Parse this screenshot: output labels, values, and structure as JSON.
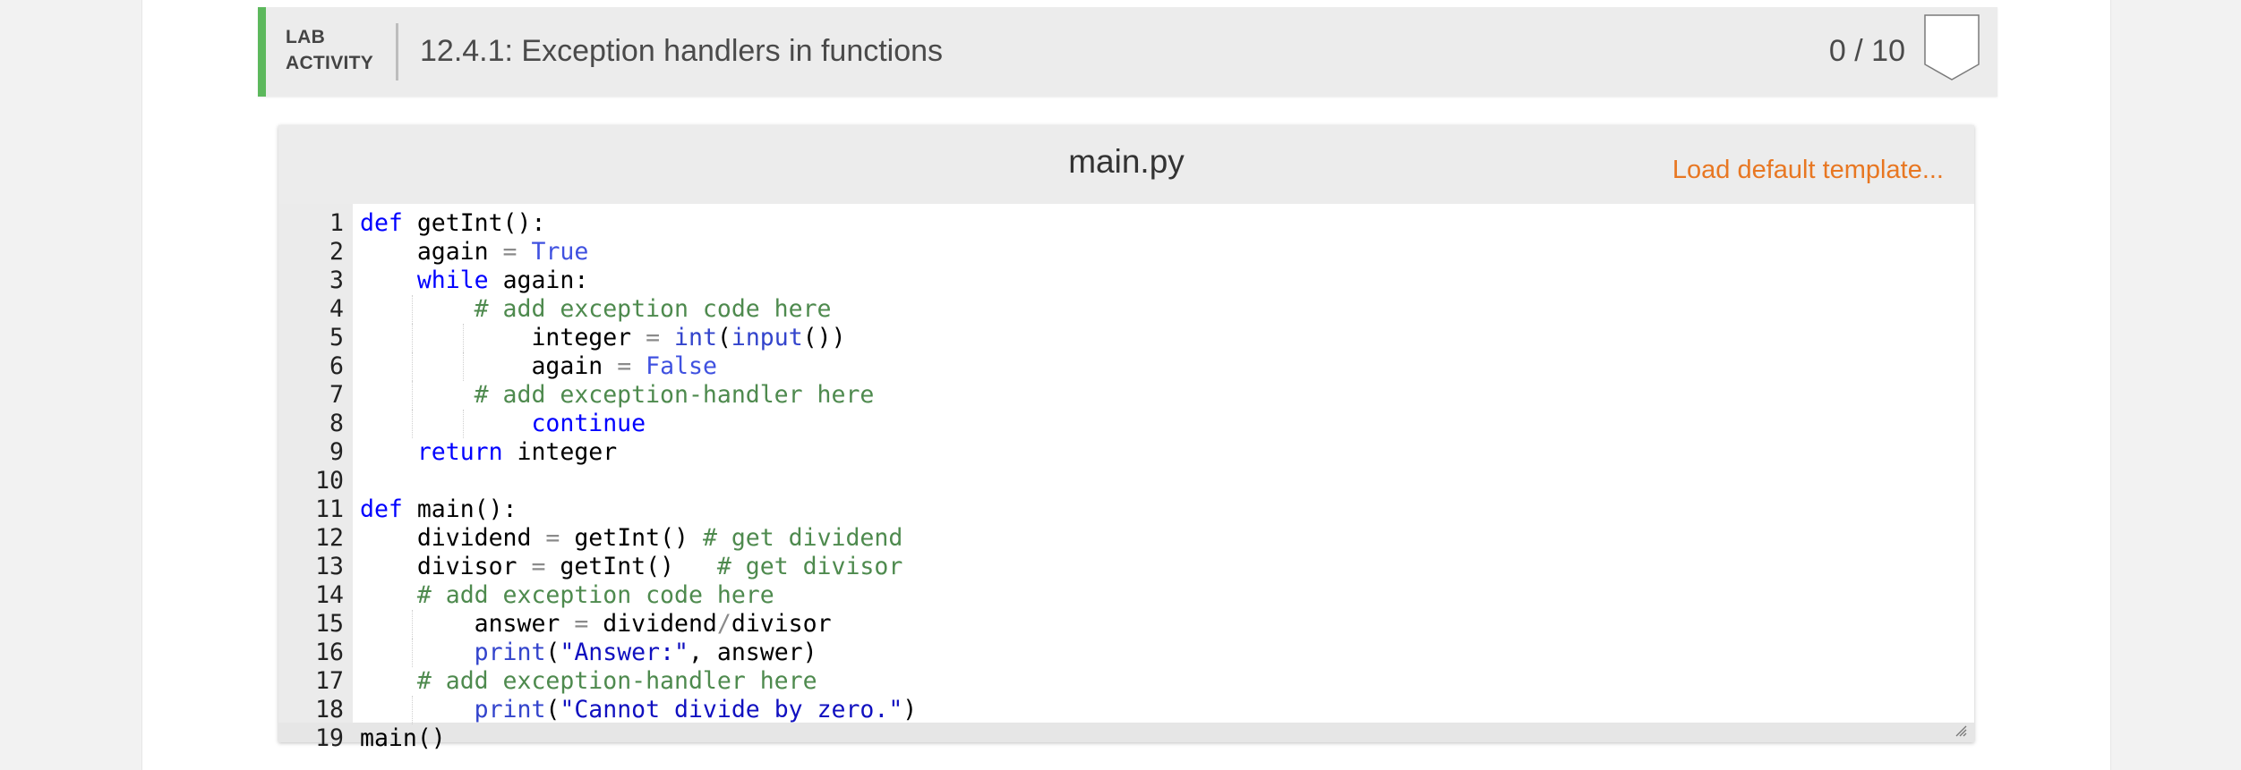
{
  "lab": {
    "label_line1": "LAB",
    "label_line2": "ACTIVITY",
    "title": "12.4.1: Exception handlers in functions",
    "score": "0 / 10",
    "accent_color": "#5cb85c",
    "badge_icon": "shield-badge-icon"
  },
  "editor": {
    "file_name": "main.py",
    "load_template_label": "Load default template...",
    "load_template_color": "#e87722",
    "line_numbers": [
      "1",
      "2",
      "3",
      "4",
      "5",
      "6",
      "7",
      "8",
      "9",
      "10",
      "11",
      "12",
      "13",
      "14",
      "15",
      "16",
      "17",
      "18",
      "19"
    ],
    "lines": [
      [
        {
          "t": "def",
          "c": "kw"
        },
        {
          "t": " getInt():"
        }
      ],
      [
        {
          "t": "    again "
        },
        {
          "t": "=",
          "c": "op"
        },
        {
          "t": " "
        },
        {
          "t": "True",
          "c": "lit"
        }
      ],
      [
        {
          "t": "    "
        },
        {
          "t": "while",
          "c": "kw"
        },
        {
          "t": " again:"
        }
      ],
      [
        {
          "t": "        "
        },
        {
          "t": "# add exception code here",
          "c": "cm"
        }
      ],
      [
        {
          "t": "            integer "
        },
        {
          "t": "=",
          "c": "op"
        },
        {
          "t": " "
        },
        {
          "t": "int",
          "c": "bi"
        },
        {
          "t": "("
        },
        {
          "t": "input",
          "c": "bi"
        },
        {
          "t": "())"
        }
      ],
      [
        {
          "t": "            again "
        },
        {
          "t": "=",
          "c": "op"
        },
        {
          "t": " "
        },
        {
          "t": "False",
          "c": "lit"
        }
      ],
      [
        {
          "t": "        "
        },
        {
          "t": "# add exception-handler here",
          "c": "cm"
        }
      ],
      [
        {
          "t": "            "
        },
        {
          "t": "continue",
          "c": "kw"
        }
      ],
      [
        {
          "t": "    "
        },
        {
          "t": "return",
          "c": "kw"
        },
        {
          "t": " integer"
        }
      ],
      [],
      [
        {
          "t": "def",
          "c": "kw"
        },
        {
          "t": " main():"
        }
      ],
      [
        {
          "t": "    dividend "
        },
        {
          "t": "=",
          "c": "op"
        },
        {
          "t": " getInt() "
        },
        {
          "t": "# get dividend",
          "c": "cm"
        }
      ],
      [
        {
          "t": "    divisor "
        },
        {
          "t": "=",
          "c": "op"
        },
        {
          "t": " getInt()   "
        },
        {
          "t": "# get divisor",
          "c": "cm"
        }
      ],
      [
        {
          "t": "    "
        },
        {
          "t": "# add exception code here",
          "c": "cm"
        }
      ],
      [
        {
          "t": "        answer "
        },
        {
          "t": "=",
          "c": "op"
        },
        {
          "t": " dividend"
        },
        {
          "t": "/",
          "c": "op"
        },
        {
          "t": "divisor"
        }
      ],
      [
        {
          "t": "        "
        },
        {
          "t": "print",
          "c": "bi"
        },
        {
          "t": "("
        },
        {
          "t": "\"Answer:\"",
          "c": "str"
        },
        {
          "t": ", answer)"
        }
      ],
      [
        {
          "t": "    "
        },
        {
          "t": "# add exception-handler here",
          "c": "cm"
        }
      ],
      [
        {
          "t": "        "
        },
        {
          "t": "print",
          "c": "bi"
        },
        {
          "t": "("
        },
        {
          "t": "\"Cannot divide by zero.\"",
          "c": "str"
        },
        {
          "t": ")"
        }
      ],
      [
        {
          "t": "main()"
        }
      ]
    ]
  }
}
